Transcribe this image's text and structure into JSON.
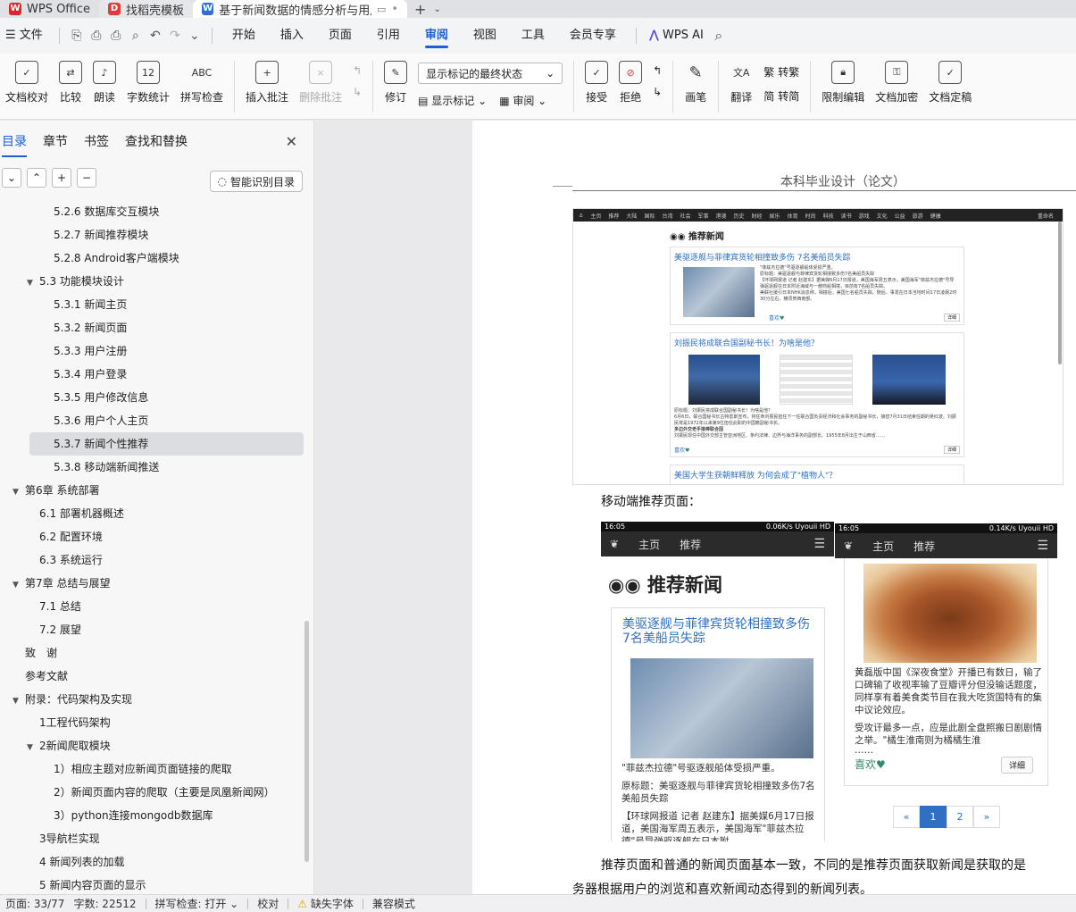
{
  "titlebar": {
    "tabs": [
      {
        "label": "WPS Office",
        "icon": "wps-logo-icon",
        "color": "#d9272e"
      },
      {
        "label": "找稻壳模板",
        "icon": "docer-icon",
        "color": "#e23b3b"
      },
      {
        "label": "基于新闻数据的情感分析与用户",
        "icon": "word-doc-icon",
        "color": "#2f6fd6"
      }
    ],
    "new_tab": "+"
  },
  "menubar": {
    "file": "文件",
    "items": [
      "开始",
      "插入",
      "页面",
      "引用",
      "审阅",
      "视图",
      "工具",
      "会员专享"
    ],
    "active": "审阅",
    "ai": "WPS AI"
  },
  "ribbon": {
    "doc_check": "文档校对",
    "compare": "比较",
    "read_aloud": "朗读",
    "word_count": "字数统计",
    "spell_check": "拼写检查",
    "insert_comment": "插入批注",
    "delete_comment": "删除批注",
    "track": "修订",
    "markup_dropdown": "显示标记的最终状态",
    "show_markup": "显示标记",
    "review": "审阅",
    "accept": "接受",
    "reject": "拒绝",
    "pen": "画笔",
    "translate": "翻译",
    "to_traditional": "转繁",
    "to_simplified": "转简",
    "restrict_edit": "限制编辑",
    "encrypt": "文档加密",
    "finalize": "文档定稿"
  },
  "sidebar": {
    "tabs": [
      "目录",
      "章节",
      "书签",
      "查找和替换"
    ],
    "smart_toc": "智能识别目录",
    "toc": [
      {
        "label": "5.2.6 数据库交互模块",
        "level": 3
      },
      {
        "label": "5.2.7 新闻推荐模块",
        "level": 3
      },
      {
        "label": "5.2.8 Android客户端模块",
        "level": 3
      },
      {
        "label": "5.3 功能模块设计",
        "level": 2,
        "expanded": true
      },
      {
        "label": "5.3.1 新闻主页",
        "level": 3
      },
      {
        "label": "5.3.2 新闻页面",
        "level": 3
      },
      {
        "label": "5.3.3 用户注册",
        "level": 3
      },
      {
        "label": "5.3.4 用户登录",
        "level": 3
      },
      {
        "label": "5.3.5 用户修改信息",
        "level": 3
      },
      {
        "label": "5.3.6 用户个人主页",
        "level": 3
      },
      {
        "label": "5.3.7 新闻个性推荐",
        "level": 3,
        "selected": true
      },
      {
        "label": "5.3.8 移动端新闻推送",
        "level": 3
      },
      {
        "label": "第6章 系统部署",
        "level": 1,
        "expanded": true
      },
      {
        "label": "6.1 部署机器概述",
        "level": 2
      },
      {
        "label": "6.2 配置环境",
        "level": 2
      },
      {
        "label": "6.3 系统运行",
        "level": 2
      },
      {
        "label": "第7章 总结与展望",
        "level": 1,
        "expanded": true
      },
      {
        "label": "7.1 总结",
        "level": 2
      },
      {
        "label": "7.2 展望",
        "level": 2
      },
      {
        "label": "致　谢",
        "level": 1
      },
      {
        "label": "参考文献",
        "level": 1
      },
      {
        "label": "附录：代码架构及实现",
        "level": 1,
        "expanded": true
      },
      {
        "label": "1工程代码架构",
        "level": 2
      },
      {
        "label": "2新闻爬取模块",
        "level": 2,
        "expanded": true
      },
      {
        "label": "1）相应主题对应新闻页面链接的爬取",
        "level": 3
      },
      {
        "label": "2）新闻页面内容的爬取（主要是凤凰新闻网）",
        "level": 3
      },
      {
        "label": "3）python连接mongodb数据库",
        "level": 3
      },
      {
        "label": "3导航栏实现",
        "level": 2
      },
      {
        "label": "4 新闻列表的加载",
        "level": 2
      },
      {
        "label": "5 新闻内容页面的显示",
        "level": 2
      }
    ]
  },
  "document": {
    "header": "本科毕业设计（论文）",
    "shot1": {
      "nav": [
        "主页",
        "推荐",
        "大陆",
        "国际",
        "台湾",
        "社会",
        "军事",
        "港澳",
        "历史",
        "财经",
        "娱乐",
        "体育",
        "时尚",
        "科技",
        "读书",
        "游戏",
        "文化",
        "公益",
        "旅游",
        "健康"
      ],
      "user": "重命名",
      "heading": "推荐新闻",
      "card1_title": "美驱逐舰与菲律宾货轮相撞致多伤 7名美船员失踪",
      "card1_lines": [
        "\"菲兹杰拉德\"号驱逐舰船体受损严重。",
        "原标题：美驱逐舰与菲律宾货轮相撞致多伤7名美船员失踪",
        "【环球网报道 记者 赵建东】据美媒6月17日报道，美国海军周五表示，美国海军\"菲兹杰拉德\"号导弹驱逐舰在日本附近海域与一艘商船相撞，目前有7名船员失踪。",
        "美联社援引日本NHK消息称，相撞后，美国七名船员失踪。随后，事发在日本当地时间17日凌晨2时30分左右，横须贺西南部。"
      ],
      "card2_title": "刘振民将成联合国副秘书长！为啥是他？",
      "card2_lines": [
        "原标题：刘振民将成联合国副秘书长！为啥是他？",
        "6月6日，联合国秘书长古特雷斯宣布，将任命刘振民担任下一任联合国负责经济和社会事务的副秘书长，接替7月31日结束任期的吴红波。刘振民将是1972年以来第9位担任此职的中国籍副秘书长。",
        "多边外交老手接棒联合国",
        "刘振民现任中国外交部主管亚洲地区、条约法律、边界与海洋事务的副部长。1955年8月出生于山西省……"
      ],
      "card3_title": "美国大学生获朝鲜释放 为何会成了\"植物人\"？",
      "like": "喜欢",
      "detail": "详细"
    },
    "mobile_label": "移动端推荐页面：",
    "phone1": {
      "time": "16:05",
      "status_right": "0.06K/s  Uyouii HD",
      "nav": [
        "主页",
        "推荐"
      ],
      "title": "推荐新闻",
      "card_title": "美驱逐舰与菲律宾货轮相撞致多伤 7名美船员失踪",
      "caption": "\"菲兹杰拉德\"号驱逐舰船体受损严重。",
      "orig": "原标题：美驱逐舰与菲律宾货轮相撞致多伤7名美船员失踪",
      "body": "【环球网报道 记者 赵建东】据美媒6月17日报道，美国海军周五表示，美国海军\"菲兹杰拉德\"号导弹驱逐舰在日本附"
    },
    "phone2": {
      "time": "16:05",
      "status_right": "0.14K/s  Uyouii HD",
      "nav": [
        "主页",
        "推荐"
      ],
      "text1": "黄磊版中国《深夜食堂》开播已有数日，输了口碑输了收视率输了豆瓣评分但没输话题度，同样享有着美食类节目在我大吃货国特有的集中议论效应。",
      "text2": "受攻讦最多一点，应是此剧全盘照搬日剧剧情之举。\"橘生淮南则为橘橘生淮",
      "dots": "……",
      "like": "喜欢",
      "detail": "详细",
      "pager": [
        "«",
        "1",
        "2",
        "»"
      ],
      "pager_active": 1
    },
    "para_line1": "推荐页面和普通的新闻页面基本一致，不同的是推荐页面获取新闻是获取的是",
    "para_line2": "务器根据用户的浏览和喜欢新闻动态得到的新闻列表。"
  },
  "statusbar": {
    "page": "页面: 33/77",
    "words": "字数: 22512",
    "spell": "拼写检查: 打开",
    "proof": "校对",
    "missing_font": "缺失字体",
    "compat": "兼容模式"
  },
  "colors": {
    "accent": "#1f5fd6",
    "link": "#2f6fc4"
  }
}
